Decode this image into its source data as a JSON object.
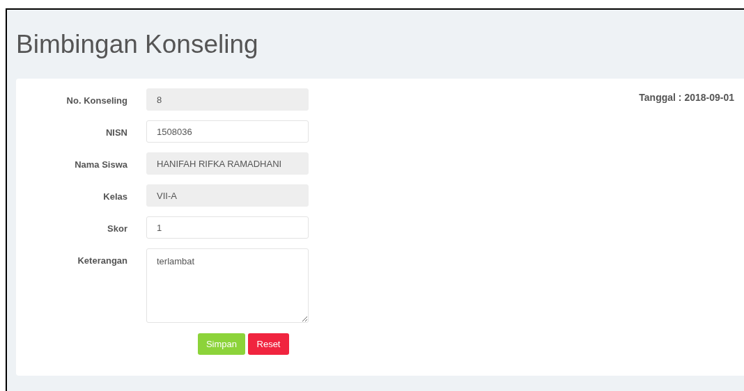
{
  "title": "Bimbingan Konseling",
  "date": "Tanggal : 2018-09-01",
  "fields": [
    {
      "kind": "input",
      "label": "No. Konseling",
      "value": "8",
      "readonly": true
    },
    {
      "kind": "input",
      "label": "NISN",
      "value": "1508036",
      "readonly": false
    },
    {
      "kind": "input",
      "label": "Nama Siswa",
      "value": "HANIFAH RIFKA RAMADHANI",
      "readonly": true
    },
    {
      "kind": "input",
      "label": "Kelas",
      "value": "VII-A",
      "readonly": true
    },
    {
      "kind": "input",
      "label": "Skor",
      "value": "1",
      "readonly": false
    },
    {
      "kind": "textarea",
      "label": "Keterangan",
      "value": "terlambat",
      "readonly": false
    }
  ],
  "buttons": [
    {
      "kind": "save",
      "label": "Simpan"
    },
    {
      "kind": "reset",
      "label": "Reset"
    }
  ]
}
